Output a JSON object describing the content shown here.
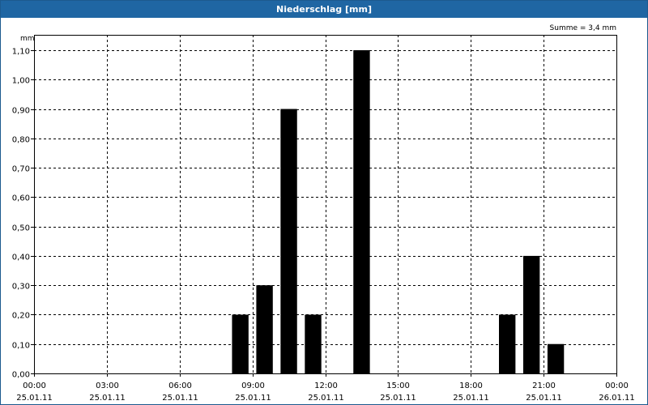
{
  "window": {
    "title": "Niederschlag [mm]"
  },
  "chart_data": {
    "type": "bar",
    "title": "Niederschlag [mm]",
    "ylabel": "mm",
    "annotation": "Summe = 3,4 mm",
    "ylim": [
      0,
      1.15
    ],
    "yticks": [
      "0,00",
      "0,10",
      "0,20",
      "0,30",
      "0,40",
      "0,50",
      "0,60",
      "0,70",
      "0,80",
      "0,90",
      "1,00",
      "1,10"
    ],
    "xlim_hours": [
      0,
      24
    ],
    "xticks": [
      {
        "time": "00:00",
        "date": "25.01.11"
      },
      {
        "time": "03:00",
        "date": "25.01.11"
      },
      {
        "time": "06:00",
        "date": "25.01.11"
      },
      {
        "time": "09:00",
        "date": "25.01.11"
      },
      {
        "time": "12:00",
        "date": "25.01.11"
      },
      {
        "time": "15:00",
        "date": "25.01.11"
      },
      {
        "time": "18:00",
        "date": "25.01.11"
      },
      {
        "time": "21:00",
        "date": "25.01.11"
      },
      {
        "time": "00:00",
        "date": "26.01.11"
      }
    ],
    "bars": [
      {
        "hour": 8.5,
        "value": 0.2
      },
      {
        "hour": 9.5,
        "value": 0.3
      },
      {
        "hour": 10.5,
        "value": 0.9
      },
      {
        "hour": 11.5,
        "value": 0.2
      },
      {
        "hour": 13.5,
        "value": 1.1
      },
      {
        "hour": 19.5,
        "value": 0.2
      },
      {
        "hour": 20.5,
        "value": 0.4
      },
      {
        "hour": 21.5,
        "value": 0.1
      }
    ],
    "bar_color": "#000000",
    "grid": true
  }
}
